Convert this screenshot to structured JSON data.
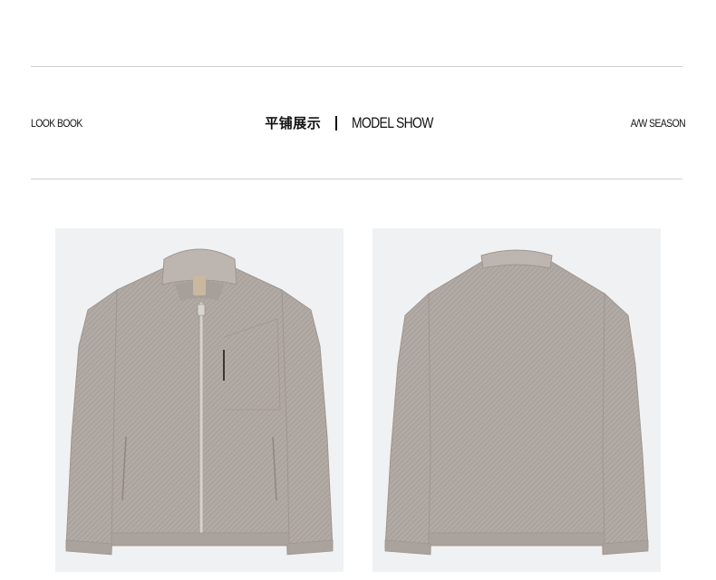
{
  "header": {
    "left_label": "LOOK BOOK",
    "title_cn": "平铺展示",
    "title_en": "MODEL SHOW",
    "right_label": "A/W SEASON"
  },
  "products": [
    {
      "view": "front",
      "icon": "jacket-front-image"
    },
    {
      "view": "back",
      "icon": "jacket-back-image"
    }
  ],
  "colors": {
    "background": "#ffffff",
    "panel": "#f0f1f3",
    "jacket": "#b3aba5",
    "rule": "#cfcfcf",
    "text": "#111111"
  }
}
